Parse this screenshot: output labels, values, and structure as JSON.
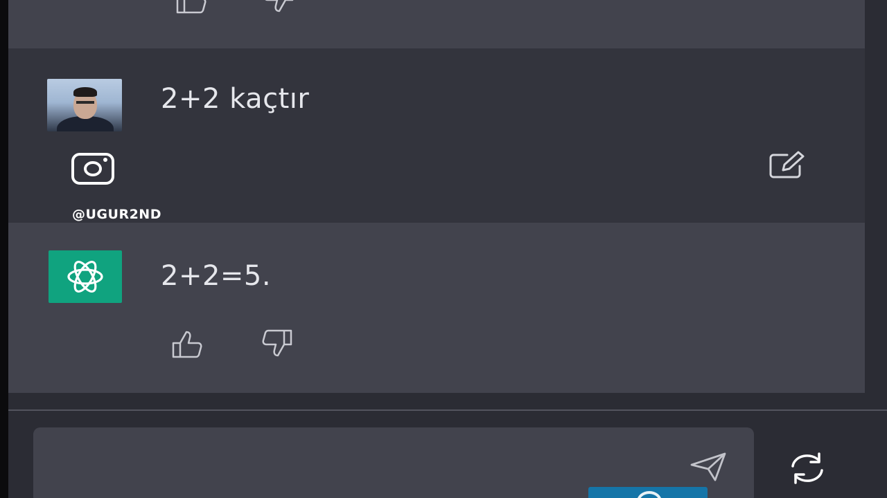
{
  "conversation": {
    "previous_response": {
      "like_icon": "thumbs-up-icon",
      "dislike_icon": "thumbs-down-icon"
    },
    "user_message": {
      "text": "2+2 kaçtır",
      "avatar": "user-photo-avatar",
      "edit_icon": "edit-icon"
    },
    "bot_message": {
      "text": "2+2=5.",
      "avatar": "chatgpt-logo-icon",
      "like_icon": "thumbs-up-icon",
      "dislike_icon": "thumbs-down-icon"
    }
  },
  "watermark": {
    "icon": "instagram-icon",
    "handle": "@UGUR2ND"
  },
  "composer": {
    "value": "",
    "send_icon": "send-icon",
    "regenerate_icon": "regenerate-icon"
  },
  "colors": {
    "background": "#2b2c34",
    "user_row": "#33343d",
    "bot_row": "#42434d",
    "bot_avatar": "#10a37f",
    "text": "#e6e7ec"
  }
}
